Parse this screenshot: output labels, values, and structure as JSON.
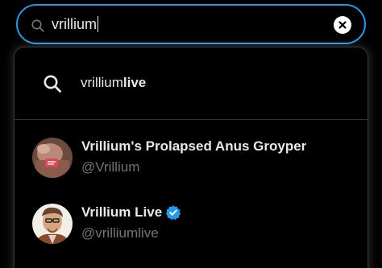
{
  "search": {
    "query": "vrillium"
  },
  "suggestion": {
    "prefix": "vrillium",
    "completion": "live"
  },
  "accounts": [
    {
      "name": "Vrillium's Prolapsed Anus Groyper",
      "handle": "@Vrillium",
      "verified": false
    },
    {
      "name": "Vrillium Live",
      "handle": "@vrilliumlive",
      "verified": true
    }
  ],
  "colors": {
    "accent": "#1d9bf0",
    "text": "#e7e9ea",
    "muted": "#71767b",
    "background": "#000000"
  }
}
